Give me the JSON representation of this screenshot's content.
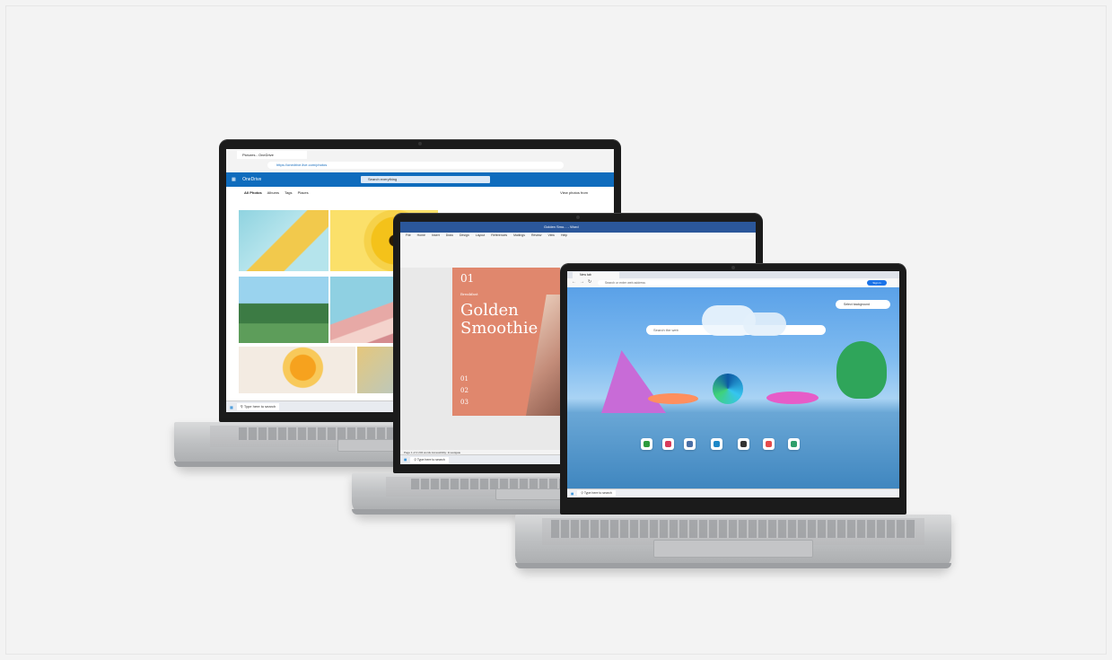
{
  "laptop_back": {
    "browser_tab": "Pictures - OneDrive",
    "url": "https://onedrive.live.com/photos",
    "app_name": "OneDrive",
    "search_placeholder": "Search everything",
    "nav": [
      "All Photos",
      "Albums",
      "Tags",
      "Places"
    ],
    "view_toggle": "View photos from",
    "taskbar_search": "Type here to search"
  },
  "laptop_mid": {
    "title": "Golden Smo... - Word",
    "menu": [
      "File",
      "Home",
      "Insert",
      "Draw",
      "Design",
      "Layout",
      "References",
      "Mailings",
      "Review",
      "View",
      "Help"
    ],
    "page_number": "01",
    "page_subtitle": "Breakfast",
    "page_heading_1": "Golden",
    "page_heading_2": "Smoothie",
    "steps": [
      "01",
      "02",
      "03"
    ],
    "status": "Page 1 of 2   234 words   Accessibility: Investigate",
    "taskbar_search": "Type here to search"
  },
  "laptop_front": {
    "tab": "New tab",
    "address_placeholder": "Search or enter web address",
    "sign_in": "Sign in",
    "search_placeholder": "Search the web",
    "personalize": "Select background",
    "taskbar_search": "Type here to search",
    "quick_link_colors": [
      "#2e9b3e",
      "#d83b5b",
      "#4a6fa5",
      "#1e88c7",
      "#333333",
      "#e54b4b",
      "#2f9e6a"
    ]
  }
}
